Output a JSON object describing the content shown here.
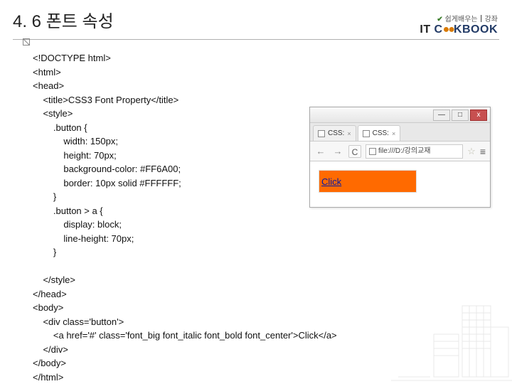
{
  "header": {
    "title": "4. 6 폰트 속성",
    "brand_small": "쉽게배우는┃강좌",
    "brand_logo_it": "IT",
    "brand_logo_c": "C",
    "brand_logo_oo": "●●",
    "brand_logo_kbook": "KBOOK"
  },
  "code": {
    "lines": [
      "<!DOCTYPE html>",
      "<html>",
      "<head>",
      "    <title>CSS3 Font Property</title>",
      "    <style>",
      "        .button {",
      "            width: 150px;",
      "            height: 70px;",
      "            background-color: #FF6A00;",
      "            border: 10px solid #FFFFFF;",
      "        }",
      "        .button > a {",
      "            display: block;",
      "            line-height: 70px;",
      "        }",
      "",
      "    </style>",
      "</head>",
      "<body>",
      "    <div class='button'>",
      "        <a href='#' class='font_big font_italic font_bold font_center'>Click</a>",
      "    </div>",
      "</body>",
      "</html>"
    ]
  },
  "browser": {
    "win_min": "—",
    "win_max": "□",
    "win_close": "x",
    "tab1": "CSS:",
    "tab2": "CSS:",
    "tab_x": "×",
    "nav_back": "←",
    "nav_fwd": "→",
    "reload": "C",
    "url": "file:///D:/강의교재",
    "star": "☆",
    "menu": "≡",
    "button_text": "Click"
  }
}
